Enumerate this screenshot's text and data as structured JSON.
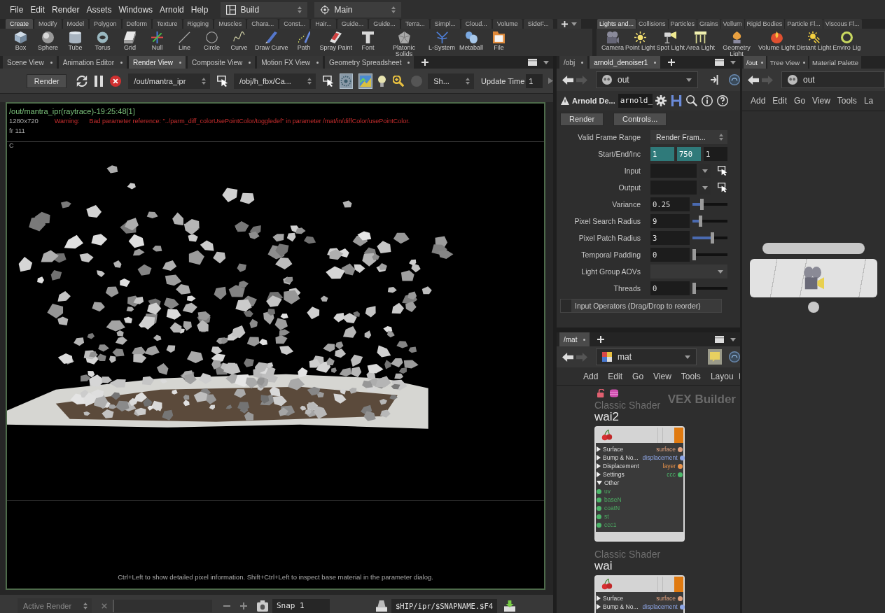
{
  "menu_bar": {
    "menus": [
      "File",
      "Edit",
      "Render",
      "Assets",
      "Windows",
      "Arnold",
      "Help"
    ],
    "desktop": "Build",
    "context": "Main"
  },
  "shelf_left": {
    "tabs": [
      {
        "label": "Create",
        "selected": true
      },
      {
        "label": "Modify",
        "selected": false
      },
      {
        "label": "Model",
        "selected": false
      },
      {
        "label": "Polygon",
        "selected": false
      },
      {
        "label": "Deform",
        "selected": false
      },
      {
        "label": "Texture",
        "selected": false
      },
      {
        "label": "Rigging",
        "selected": false
      },
      {
        "label": "Muscles",
        "selected": false
      },
      {
        "label": "Chara...",
        "selected": false
      },
      {
        "label": "Const...",
        "selected": false
      },
      {
        "label": "Hair...",
        "selected": false
      },
      {
        "label": "Guide...",
        "selected": false
      },
      {
        "label": "Guide...",
        "selected": false
      },
      {
        "label": "Terra...",
        "selected": false
      },
      {
        "label": "Simpl...",
        "selected": false
      },
      {
        "label": "Cloud...",
        "selected": false
      },
      {
        "label": "Volume",
        "selected": false
      },
      {
        "label": "SideF...",
        "selected": false
      }
    ],
    "tools": [
      "Box",
      "Sphere",
      "Tube",
      "Torus",
      "Grid",
      "Null",
      "Line",
      "Circle",
      "Curve",
      "Draw Curve",
      "Path",
      "Spray Paint",
      "Font",
      "Platonic Solids",
      "L-System",
      "Metaball",
      "File"
    ]
  },
  "shelf_right": {
    "tabs": [
      {
        "label": "Lights and...",
        "selected": true
      },
      {
        "label": "Collisions",
        "selected": false
      },
      {
        "label": "Particles",
        "selected": false
      },
      {
        "label": "Grains",
        "selected": false
      },
      {
        "label": "Vellum",
        "selected": false
      },
      {
        "label": "Rigid Bodies",
        "selected": false
      },
      {
        "label": "Particle Fl...",
        "selected": false
      },
      {
        "label": "Viscous Fl...",
        "selected": false
      }
    ],
    "tools": [
      "Camera",
      "Point Light",
      "Spot Light",
      "Area Light",
      "Geometry Light",
      "Volume Light",
      "Distant Light",
      "Enviro Lig"
    ]
  },
  "render_pane": {
    "tabs": [
      {
        "label": "Scene View",
        "selected": false
      },
      {
        "label": "Animation Editor",
        "selected": false
      },
      {
        "label": "Render View",
        "selected": true
      },
      {
        "label": "Composite View",
        "selected": false
      },
      {
        "label": "Motion FX View",
        "selected": false
      },
      {
        "label": "Geometry Spreadsheet",
        "selected": false
      }
    ],
    "toolbar": {
      "render": "Render",
      "driver": "/out/mantra_ipr",
      "camera": "/obj/h_fbx/Ca...",
      "toggles": [
        {
          "on": true
        },
        {
          "on": true
        }
      ],
      "display": "Sh...",
      "update_label": "Update Time",
      "update_value": "1"
    },
    "viewport": {
      "title": "/out/mantra_ipr(raytrace)-19:25:48[1]",
      "resolution": "1280x720",
      "warning_label": "Warning:",
      "warning": "Bad parameter reference: \"../parm_diff_colorUsePointColor/toggledef\" in parameter /mat/in/diffColor/usePointColor.",
      "frame": "fr 111",
      "channel": "C",
      "hint": "Ctrl+Left to show detailed pixel information. Shift+Ctrl+Left to inspect base material in the parameter dialog."
    },
    "bottom_bar": {
      "active_render": "Active Render",
      "snap": "Snap 1",
      "snapshot_path": "$HIP/ipr/$SNAPNAME.$F4"
    }
  },
  "parameter_pane": {
    "tabs": [
      {
        "label": "/obj",
        "selected": false
      },
      {
        "label": "arnold_denoiser1",
        "selected": true
      }
    ],
    "path": "out",
    "node_type": "Arnold De...",
    "node_name": "arnold_",
    "buttons": [
      "Render",
      "Controls..."
    ],
    "parameters": [
      {
        "kind": "menu",
        "label": "Valid Frame Range",
        "value": "Render Fram..."
      },
      {
        "kind": "vector",
        "label": "Start/End/Inc",
        "values": [
          {
            "value": "1",
            "expression": true
          },
          {
            "value": "750",
            "expression": true
          },
          {
            "value": "1",
            "expression": false
          }
        ]
      },
      {
        "kind": "operator",
        "label": "Input"
      },
      {
        "kind": "operator",
        "label": "Output"
      },
      {
        "kind": "slider",
        "label": "Variance",
        "value": "0.25",
        "level": 0.25
      },
      {
        "kind": "slider",
        "label": "Pixel Search Radius",
        "value": "9",
        "level": 0.2
      },
      {
        "kind": "slider",
        "label": "Pixel Patch Radius",
        "value": "3",
        "level": 0.58
      },
      {
        "kind": "slider",
        "label": "Temporal Padding",
        "value": "0",
        "level": 0
      },
      {
        "kind": "menu",
        "label": "Light Group AOVs"
      },
      {
        "kind": "slider",
        "label": "Threads",
        "value": "0",
        "level": 0
      }
    ],
    "multiparm": "Input Operators (Drag/Drop to reorder)"
  },
  "mat_pane": {
    "tabs": [
      {
        "label": "/mat",
        "selected": true
      }
    ],
    "path": "mat",
    "toggle_on": true,
    "menus": [
      "Add",
      "Edit",
      "Go",
      "View",
      "Tools",
      "Layou"
    ],
    "context_label": "VEX Builder",
    "nodes": [
      {
        "type": "Classic Shader",
        "name": "wai2",
        "flags_shown": true,
        "sections": [
          {
            "label": "Surface",
            "expanded": false,
            "output": "surface",
            "color": "#e2a27e"
          },
          {
            "label": "Bump & No...",
            "expanded": false,
            "output": "displacement",
            "color": "#8ea6e6"
          },
          {
            "label": "Displacement",
            "expanded": false,
            "output": "layer",
            "color": "#e8924a"
          },
          {
            "label": "Settings",
            "expanded": false,
            "output": "ccc",
            "color": "#4cb86a"
          },
          {
            "label": "Other",
            "expanded": true,
            "inputs": [
              "uv",
              "baseN",
              "coatN",
              "st",
              "ccc1"
            ]
          }
        ]
      },
      {
        "type": "Classic Shader",
        "name": "wai",
        "flags_shown": false,
        "sections": [
          {
            "label": "Surface",
            "expanded": false,
            "output": "surface",
            "color": "#e2a27e"
          },
          {
            "label": "Bump & No...",
            "expanded": false,
            "output": "displacement",
            "color": "#8ea6e6"
          }
        ]
      }
    ]
  },
  "out_pane": {
    "tabs": [
      {
        "label": "/out",
        "selected": true
      },
      {
        "label": "Tree View",
        "selected": false
      },
      {
        "label": "Material Palette",
        "selected": false
      }
    ],
    "path": "out",
    "menus": [
      "Add",
      "Edit",
      "Go",
      "View",
      "Tools",
      "La"
    ]
  }
}
